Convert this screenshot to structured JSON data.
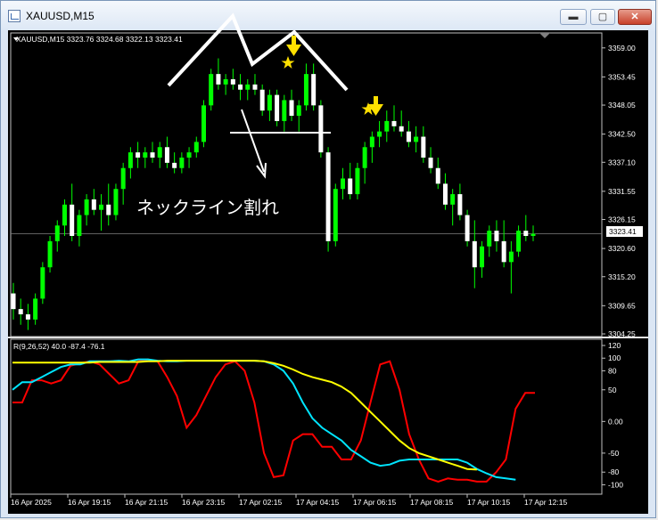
{
  "window": {
    "title": "XAUUSD,M15",
    "controls": {
      "minimize": "▬",
      "maximize": "▢",
      "close": "✕"
    }
  },
  "chart_header": "XAUUSD,M15  3323.76 3324.68 3322.13 3323.41",
  "annotation": "ネックライン割れ",
  "price_axis": {
    "ticks": [
      "3359.00",
      "3353.45",
      "3348.05",
      "3342.50",
      "3337.10",
      "3331.55",
      "3326.15",
      "3320.60",
      "3315.20",
      "3309.65",
      "3304.25"
    ],
    "current": "3323.41"
  },
  "indicator": {
    "header": "R(9,26,52) 40.0 -87.4 -76.1",
    "ticks": [
      "120",
      "100",
      "80",
      "50",
      "0.00",
      "-50",
      "-80",
      "-100"
    ]
  },
  "time_axis": [
    "16 Apr 2025",
    "16 Apr 19:15",
    "16 Apr 21:15",
    "16 Apr 23:15",
    "17 Apr 02:15",
    "17 Apr 04:15",
    "17 Apr 06:15",
    "17 Apr 08:15",
    "17 Apr 10:15",
    "17 Apr 12:15"
  ],
  "colors": {
    "bg": "#000000",
    "bull": "#00ff00",
    "bear": "#ffffff",
    "grid": "#ffffff",
    "yellow": "#ffff00",
    "cyan": "#00e5ff",
    "red": "#ff0000",
    "marker": "#ffe000"
  },
  "chart_data": [
    {
      "type": "candlestick",
      "symbol": "XAUUSD",
      "timeframe": "M15",
      "ylim": [
        3304.25,
        3360.5
      ],
      "candles": [
        [
          3312,
          3314,
          3307,
          3309
        ],
        [
          3309,
          3311,
          3306,
          3308
        ],
        [
          3308,
          3310,
          3305,
          3307
        ],
        [
          3307,
          3312,
          3306,
          3311
        ],
        [
          3311,
          3318,
          3310,
          3317
        ],
        [
          3317,
          3323,
          3316,
          3322
        ],
        [
          3322,
          3326,
          3320,
          3325
        ],
        [
          3325,
          3330,
          3323,
          3329
        ],
        [
          3329,
          3333,
          3322,
          3323
        ],
        [
          3323,
          3328,
          3321,
          3327
        ],
        [
          3327,
          3331,
          3325,
          3330
        ],
        [
          3330,
          3332,
          3327,
          3328
        ],
        [
          3328,
          3331,
          3324,
          3329
        ],
        [
          3329,
          3333,
          3325,
          3327
        ],
        [
          3327,
          3333,
          3326,
          3332
        ],
        [
          3332,
          3337,
          3329,
          3336
        ],
        [
          3336,
          3340,
          3334,
          3339
        ],
        [
          3339,
          3341,
          3336,
          3338
        ],
        [
          3338,
          3340,
          3336,
          3339
        ],
        [
          3339,
          3341,
          3337,
          3338
        ],
        [
          3338,
          3341,
          3336,
          3340
        ],
        [
          3340,
          3342,
          3336,
          3337
        ],
        [
          3337,
          3339,
          3335,
          3336
        ],
        [
          3336,
          3339,
          3335,
          3338
        ],
        [
          3338,
          3340,
          3336,
          3339
        ],
        [
          3339,
          3342,
          3338,
          3341
        ],
        [
          3341,
          3349,
          3340,
          3348
        ],
        [
          3348,
          3355,
          3347,
          3354
        ],
        [
          3354,
          3357,
          3351,
          3352
        ],
        [
          3352,
          3354,
          3350,
          3353
        ],
        [
          3353,
          3355,
          3351,
          3352
        ],
        [
          3352,
          3354,
          3349,
          3351
        ],
        [
          3351,
          3353,
          3349,
          3352
        ],
        [
          3352,
          3354,
          3350,
          3351
        ],
        [
          3351,
          3352,
          3346,
          3347
        ],
        [
          3347,
          3351,
          3345,
          3350
        ],
        [
          3350,
          3351,
          3344,
          3345
        ],
        [
          3345,
          3350,
          3343,
          3349
        ],
        [
          3349,
          3351,
          3345,
          3346
        ],
        [
          3346,
          3349,
          3343,
          3348
        ],
        [
          3348,
          3356,
          3347,
          3354
        ],
        [
          3354,
          3356,
          3347,
          3348
        ],
        [
          3348,
          3349,
          3338,
          3339
        ],
        [
          3339,
          3340,
          3320,
          3322
        ],
        [
          3322,
          3333,
          3321,
          3332
        ],
        [
          3332,
          3336,
          3330,
          3334
        ],
        [
          3334,
          3337,
          3330,
          3331
        ],
        [
          3331,
          3337,
          3330,
          3336
        ],
        [
          3336,
          3341,
          3333,
          3340
        ],
        [
          3340,
          3343,
          3337,
          3342
        ],
        [
          3342,
          3345,
          3340,
          3343
        ],
        [
          3343,
          3347,
          3341,
          3345
        ],
        [
          3345,
          3348,
          3343,
          3344
        ],
        [
          3344,
          3347,
          3342,
          3343
        ],
        [
          3343,
          3345,
          3340,
          3341
        ],
        [
          3341,
          3344,
          3339,
          3342
        ],
        [
          3342,
          3344,
          3337,
          3338
        ],
        [
          3338,
          3340,
          3335,
          3336
        ],
        [
          3336,
          3338,
          3332,
          3333
        ],
        [
          3333,
          3335,
          3328,
          3329
        ],
        [
          3329,
          3332,
          3325,
          3331
        ],
        [
          3331,
          3333,
          3326,
          3327
        ],
        [
          3327,
          3328,
          3321,
          3322
        ],
        [
          3322,
          3326,
          3313,
          3317
        ],
        [
          3317,
          3322,
          3315,
          3321
        ],
        [
          3321,
          3325,
          3319,
          3324
        ],
        [
          3324,
          3326,
          3320,
          3322
        ],
        [
          3322,
          3326,
          3317,
          3318
        ],
        [
          3318,
          3322,
          3312,
          3320
        ],
        [
          3320,
          3325,
          3319,
          3324
        ],
        [
          3324,
          3327,
          3322,
          3323
        ],
        [
          3323,
          3325,
          3322,
          3323.41
        ]
      ]
    },
    {
      "type": "line",
      "name": "R(9,26,52)",
      "ylim": [
        -105,
        120
      ],
      "series": [
        {
          "color": "#ff0000",
          "values": [
            30,
            30,
            65,
            65,
            60,
            65,
            88,
            92,
            95,
            90,
            75,
            60,
            65,
            95,
            98,
            95,
            70,
            40,
            -10,
            10,
            40,
            70,
            90,
            95,
            80,
            30,
            -50,
            -88,
            -85,
            -30,
            -20,
            -20,
            -40,
            -40,
            -60,
            -60,
            -30,
            30,
            90,
            95,
            50,
            -20,
            -60,
            -90,
            -95,
            -90,
            -92,
            -92,
            -95,
            -95,
            -80,
            -60,
            20,
            45,
            45
          ]
        },
        {
          "color": "#00e5ff",
          "values": [
            50,
            62,
            62,
            70,
            78,
            86,
            90,
            90,
            95,
            95,
            95,
            96,
            95,
            98,
            98,
            96,
            95,
            95,
            96,
            96,
            96,
            96,
            96,
            96,
            96,
            96,
            95,
            90,
            80,
            60,
            30,
            5,
            -10,
            -20,
            -30,
            -45,
            -55,
            -65,
            -70,
            -68,
            -62,
            -60,
            -60,
            -60,
            -60,
            -60,
            -60,
            -65,
            -75,
            -82,
            -88,
            -90,
            -92
          ]
        },
        {
          "color": "#ffff00",
          "values": [
            93,
            93,
            93,
            93,
            93,
            93,
            93,
            93,
            93,
            94,
            94,
            94,
            94,
            94,
            95,
            95,
            96,
            96,
            96,
            96,
            96,
            96,
            96,
            96,
            96,
            96,
            95,
            92,
            88,
            82,
            75,
            70,
            66,
            62,
            55,
            45,
            30,
            15,
            0,
            -15,
            -30,
            -42,
            -50,
            -55,
            -60,
            -65,
            -70,
            -75,
            -76
          ]
        }
      ]
    }
  ]
}
